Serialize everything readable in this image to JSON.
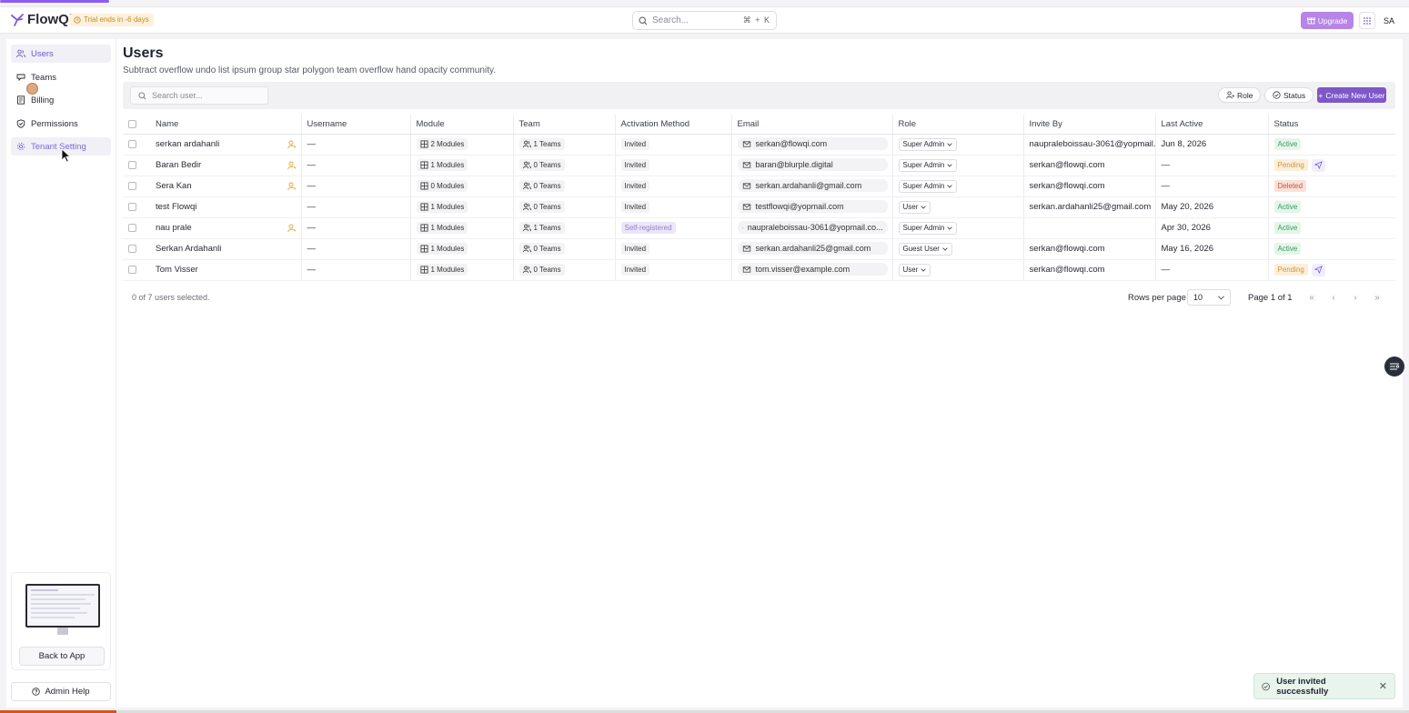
{
  "app": {
    "name": "FlowQi",
    "trial": "Trial ends in -6 days",
    "upgrade": "Upgrade",
    "avatar": "SA"
  },
  "search": {
    "placeholder": "Search...",
    "shortcut": "⌘ + K"
  },
  "sidebar": {
    "items": [
      {
        "label": "Users",
        "icon": "users-icon"
      },
      {
        "label": "Teams",
        "icon": "teams-icon"
      },
      {
        "label": "Billing",
        "icon": "billing-icon"
      },
      {
        "label": "Permissions",
        "icon": "shield-icon"
      },
      {
        "label": "Tenant Setting",
        "icon": "gear-icon"
      }
    ],
    "back_label": "Back to App",
    "help_label": "Admin Help"
  },
  "page": {
    "title": "Users",
    "description": "Subtract overflow undo list ipsum group star polygon team overflow hand opacity community."
  },
  "toolbar": {
    "search_placeholder": "Search user...",
    "role_label": "Role",
    "status_label": "Status",
    "create_label": "Create New User"
  },
  "table": {
    "columns": [
      "Name",
      "Username",
      "Module",
      "Team",
      "Activation Method",
      "Email",
      "Role",
      "Invite By",
      "Last Active",
      "Status"
    ],
    "rows": [
      {
        "name": "serkan ardahanli",
        "username": "—",
        "module": "2 Modules",
        "team": "1 Teams",
        "activation": "Invited",
        "email": "serkan@flowqi.com",
        "role": "Super Admin",
        "invite_by": "naupraleboissau-3061@yopmail...",
        "last_active": "Jun 8, 2026",
        "status": "Active"
      },
      {
        "name": "Baran Bedir",
        "username": "—",
        "module": "1 Modules",
        "team": "0 Teams",
        "activation": "Invited",
        "email": "baran@blurple.digital",
        "role": "Super Admin",
        "invite_by": "serkan@flowqi.com",
        "last_active": "—",
        "status": "Pending"
      },
      {
        "name": "Sera Kan",
        "username": "—",
        "module": "0 Modules",
        "team": "0 Teams",
        "activation": "Invited",
        "email": "serkan.ardahanli@gmail.com",
        "role": "Super Admin",
        "invite_by": "serkan@flowqi.com",
        "last_active": "—",
        "status": "Deleted"
      },
      {
        "name": "test Flowqi",
        "username": "—",
        "module": "1 Modules",
        "team": "0 Teams",
        "activation": "Invited",
        "email": "testflowqi@yopmail.com",
        "role": "User",
        "invite_by": "serkan.ardahanli25@gmail.com",
        "last_active": "May 20, 2026",
        "status": "Active"
      },
      {
        "name": "nau prale",
        "username": "—",
        "module": "1 Modules",
        "team": "1 Teams",
        "activation": "Self-registered",
        "email": "naupraleboissau-3061@yopmail.co...",
        "role": "Super Admin",
        "invite_by": "",
        "last_active": "Apr 30, 2026",
        "status": "Active"
      },
      {
        "name": "Serkan Ardahanli",
        "username": "—",
        "module": "1 Modules",
        "team": "0 Teams",
        "activation": "Invited",
        "email": "serkan.ardahanli25@gmail.com",
        "role": "Guest User",
        "invite_by": "serkan@flowqi.com",
        "last_active": "May 16, 2026",
        "status": "Active"
      },
      {
        "name": "Tom Visser",
        "username": "—",
        "module": "1 Modules",
        "team": "0 Teams",
        "activation": "Invited",
        "email": "tom.visser@example.com",
        "role": "User",
        "invite_by": "serkan@flowqi.com",
        "last_active": "—",
        "status": "Pending"
      }
    ]
  },
  "footer": {
    "selection": "0 of 7 users selected.",
    "rows_per_page_label": "Rows per page",
    "rows_per_page_value": "10",
    "page_label": "Page 1 of 1"
  },
  "toast": {
    "message": "User invited successfully"
  },
  "colors": {
    "accent": "#7e57c9",
    "upgrade": "#b784e8",
    "active": "#3c9a5f",
    "pending": "#d4953e",
    "deleted": "#c8573a"
  }
}
